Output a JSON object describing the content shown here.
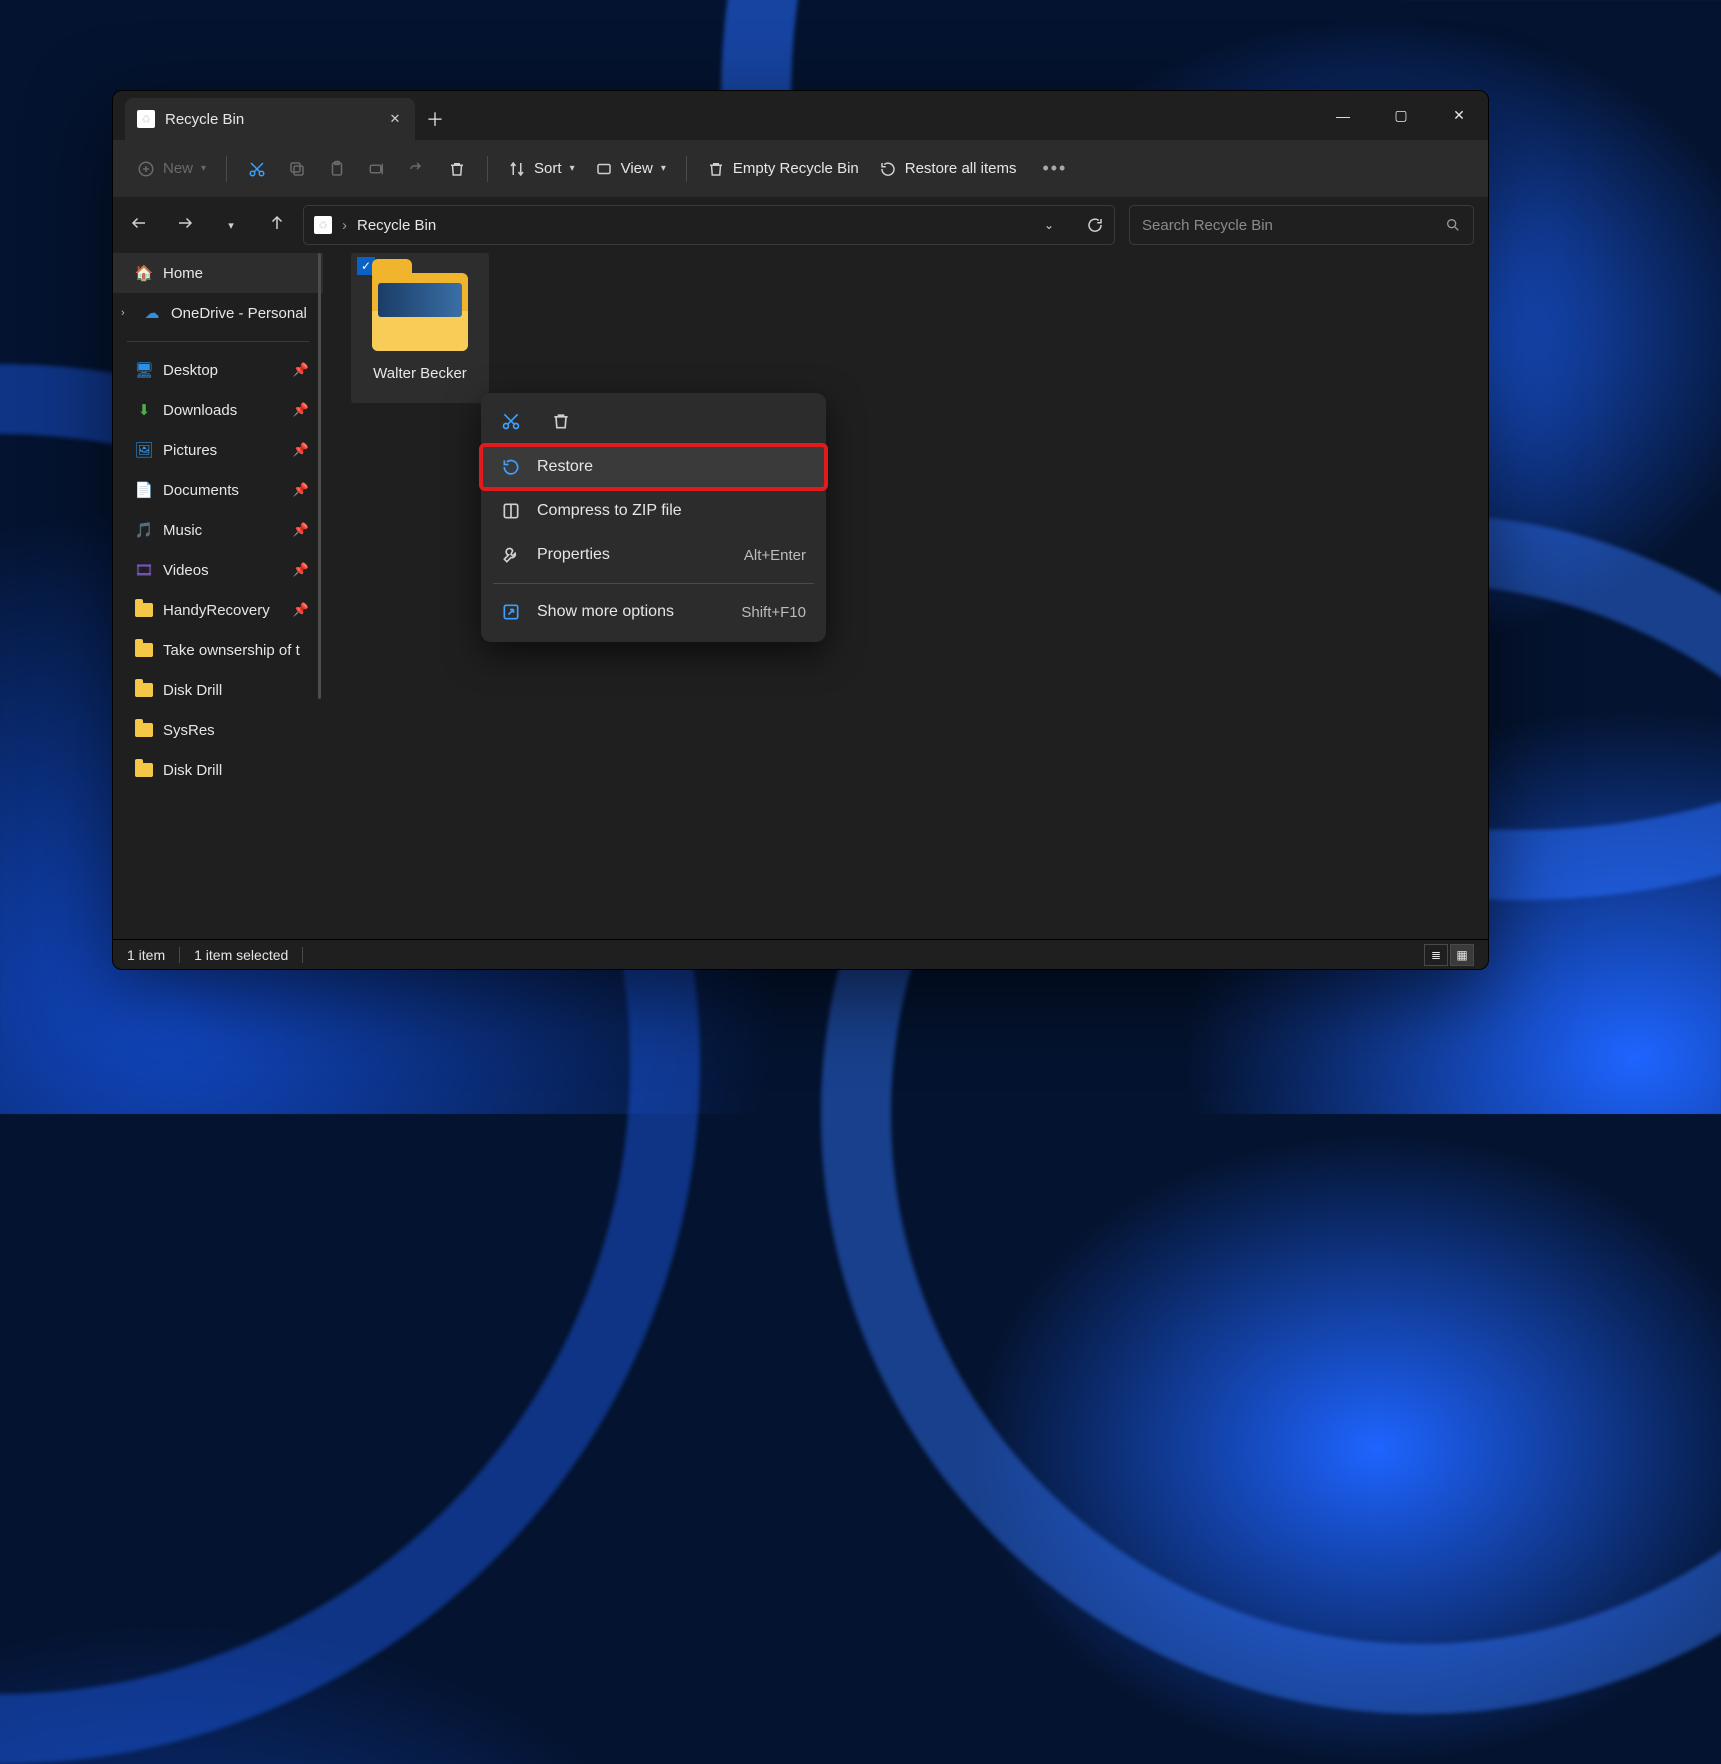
{
  "tab": {
    "title": "Recycle Bin"
  },
  "cmdbar": {
    "new": "New",
    "sort": "Sort",
    "view": "View",
    "empty": "Empty Recycle Bin",
    "restore_all": "Restore all items"
  },
  "address": {
    "path": "Recycle Bin"
  },
  "search": {
    "placeholder": "Search Recycle Bin"
  },
  "sidebar": {
    "home": "Home",
    "onedrive": "OneDrive - Personal",
    "items": [
      {
        "label": "Desktop"
      },
      {
        "label": "Downloads"
      },
      {
        "label": "Pictures"
      },
      {
        "label": "Documents"
      },
      {
        "label": "Music"
      },
      {
        "label": "Videos"
      },
      {
        "label": "HandyRecovery"
      },
      {
        "label": "Take ownsership of t"
      },
      {
        "label": "Disk Drill"
      },
      {
        "label": "SysRes"
      },
      {
        "label": "Disk Drill"
      }
    ]
  },
  "files": [
    {
      "name": "Walter Becker",
      "selected": true
    }
  ],
  "context": {
    "restore": "Restore",
    "compress": "Compress to ZIP file",
    "properties": "Properties",
    "properties_shortcut": "Alt+Enter",
    "more": "Show more options",
    "more_shortcut": "Shift+F10"
  },
  "status": {
    "count": "1 item",
    "selected": "1 item selected"
  }
}
